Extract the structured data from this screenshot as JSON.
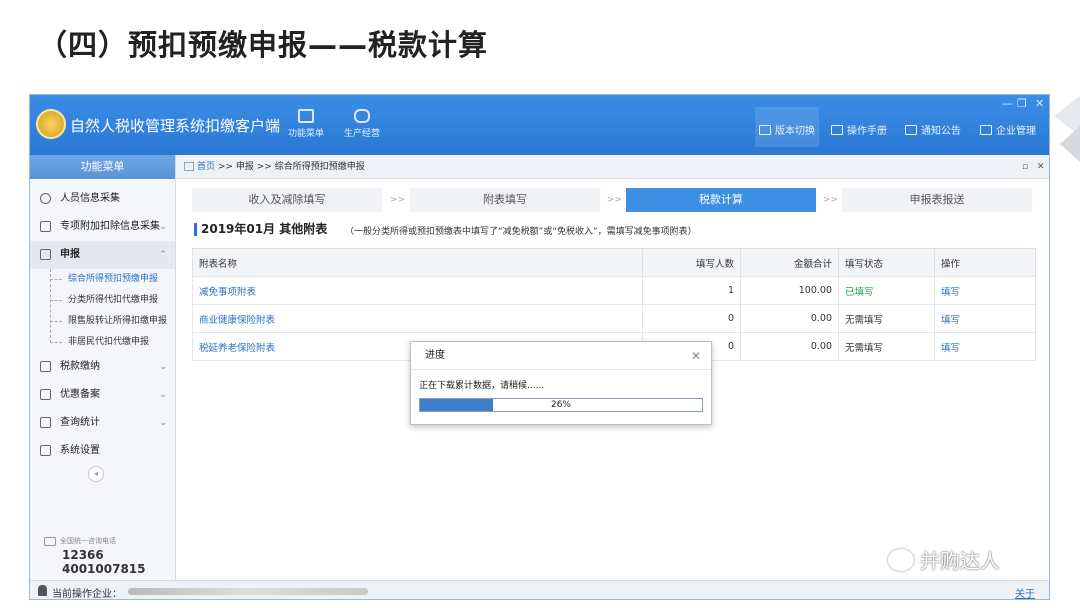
{
  "slide": {
    "title": "（四）预扣预缴申报——税款计算"
  },
  "header": {
    "app_title": "自然人税收管理系统扣缴客户端",
    "tools": [
      {
        "label": "功能菜单"
      },
      {
        "label": "生产经营"
      }
    ],
    "right_menu": [
      {
        "label": "版本切换"
      },
      {
        "label": "操作手册"
      },
      {
        "label": "通知公告"
      },
      {
        "label": "企业管理"
      }
    ],
    "window_controls": [
      "—",
      "❐",
      "✕"
    ]
  },
  "sidebar": {
    "heading": "功能菜单",
    "items": [
      {
        "label": "人员信息采集"
      },
      {
        "label": "专项附加扣除信息采集"
      },
      {
        "label": "申报"
      },
      {
        "label": "税款缴纳"
      },
      {
        "label": "优惠备案"
      },
      {
        "label": "查询统计"
      },
      {
        "label": "系统设置"
      }
    ],
    "sub_items": [
      {
        "label": "综合所得预扣预缴申报"
      },
      {
        "label": "分类所得代扣代缴申报"
      },
      {
        "label": "限售股转让所得扣缴申报"
      },
      {
        "label": "非居民代扣代缴申报"
      }
    ],
    "hotline_label": "全国统一咨询电话",
    "phones": [
      "12366",
      "4001007815"
    ]
  },
  "breadcrumb": {
    "home": "首页",
    "sep": ">>",
    "parts": [
      "申报",
      "综合所得预扣预缴申报"
    ]
  },
  "steps": [
    {
      "label": "收入及减除填写"
    },
    {
      "label": "附表填写"
    },
    {
      "label": "税款计算"
    },
    {
      "label": "申报表报送"
    }
  ],
  "step_sep": ">>",
  "section": {
    "title": "2019年01月 其他附表",
    "note": "（一般分类所得或预扣预缴表中填写了“减免税额”或“免税收入”，需填写减免事项附表）"
  },
  "table": {
    "headers": [
      "附表名称",
      "填写人数",
      "金额合计",
      "填写状态",
      "操作"
    ],
    "rows": [
      {
        "name": "减免事项附表",
        "count": "1",
        "amount": "100.00",
        "status": "已填写",
        "op": "填写"
      },
      {
        "name": "商业健康保险附表",
        "count": "0",
        "amount": "0.00",
        "status": "无需填写",
        "op": "填写"
      },
      {
        "name": "税延养老保险附表",
        "count": "0",
        "amount": "0.00",
        "status": "无需填写",
        "op": "填写"
      }
    ]
  },
  "dialog": {
    "title": "进度",
    "message": "正在下载累计数据，请稍候......",
    "progress": 26,
    "progress_label": "26%"
  },
  "status_bar": {
    "label": "当前操作企业：",
    "about": "关于"
  },
  "watermark": "并购达人"
}
